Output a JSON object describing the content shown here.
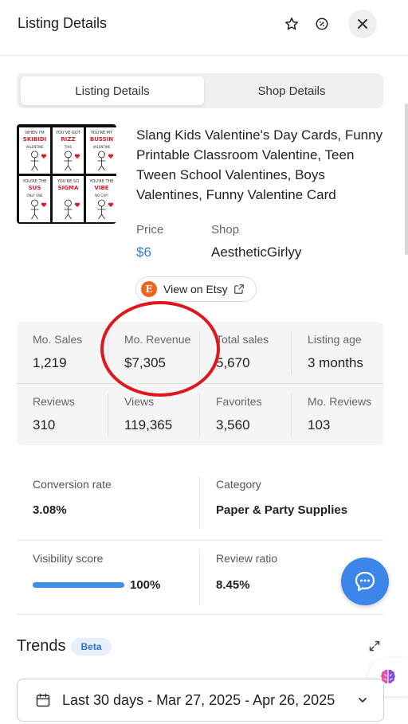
{
  "header": {
    "title": "Listing Details",
    "icons": [
      "star-icon",
      "badge-percent-icon",
      "close-icon"
    ]
  },
  "tabs": [
    {
      "label": "Listing Details",
      "active": true
    },
    {
      "label": "Shop Details",
      "active": false
    }
  ],
  "listing": {
    "title": "Slang Kids Valentine's Day Cards, Funny Printable Classroom Valentine, Teen Tween School Valentines, Boys Valentines, Funny Valentine Card",
    "price_label": "Price",
    "price": "$6",
    "shop_label": "Shop",
    "shop": "AestheticGirlyy",
    "etsy_button": "View on Etsy",
    "etsy_logo_letter": "E"
  },
  "thumbnail_cards": [
    {
      "top": "WHEN I'M",
      "main": "SKIBIDI",
      "sub": "VALENTINE"
    },
    {
      "top": "YOU'VE GOT",
      "main": "RIZZ",
      "sub": "THIS"
    },
    {
      "top": "YOU'RE MY",
      "main": "BUSSIN",
      "sub": "VALENTINE"
    },
    {
      "top": "YOU'RE THE",
      "main": "SUS",
      "sub": "ONLY ONE"
    },
    {
      "top": "YOU'RE SO",
      "main": "SIGMA",
      "sub": ""
    },
    {
      "top": "YOU'RE THE",
      "main": "VIBE",
      "sub": "NO CAP!"
    }
  ],
  "stats": [
    {
      "label": "Mo. Sales",
      "value": "1,219"
    },
    {
      "label": "Mo. Revenue",
      "value": "$7,305"
    },
    {
      "label": "Total sales",
      "value": "5,670"
    },
    {
      "label": "Listing age",
      "value": "3 months"
    },
    {
      "label": "Reviews",
      "value": "310"
    },
    {
      "label": "Views",
      "value": "119,365"
    },
    {
      "label": "Favorites",
      "value": "3,560"
    },
    {
      "label": "Mo. Reviews",
      "value": "103"
    }
  ],
  "metrics": {
    "conversion_label": "Conversion rate",
    "conversion_value": "3.08%",
    "category_label": "Category",
    "category_value": "Paper & Party Supplies",
    "visibility_label": "Visibility score",
    "visibility_value": "100%",
    "visibility_fraction": 1.0,
    "review_ratio_label": "Review ratio",
    "review_ratio_value": "8.45%"
  },
  "trends": {
    "title": "Trends",
    "badge": "Beta",
    "date_range": "Last 30 days - Mar 27, 2025 - Apr 26, 2025"
  },
  "colors": {
    "accent": "#3b86e8",
    "price": "#2f7fd0",
    "etsy": "#f1641e",
    "annotation_circle": "#e0161d"
  }
}
